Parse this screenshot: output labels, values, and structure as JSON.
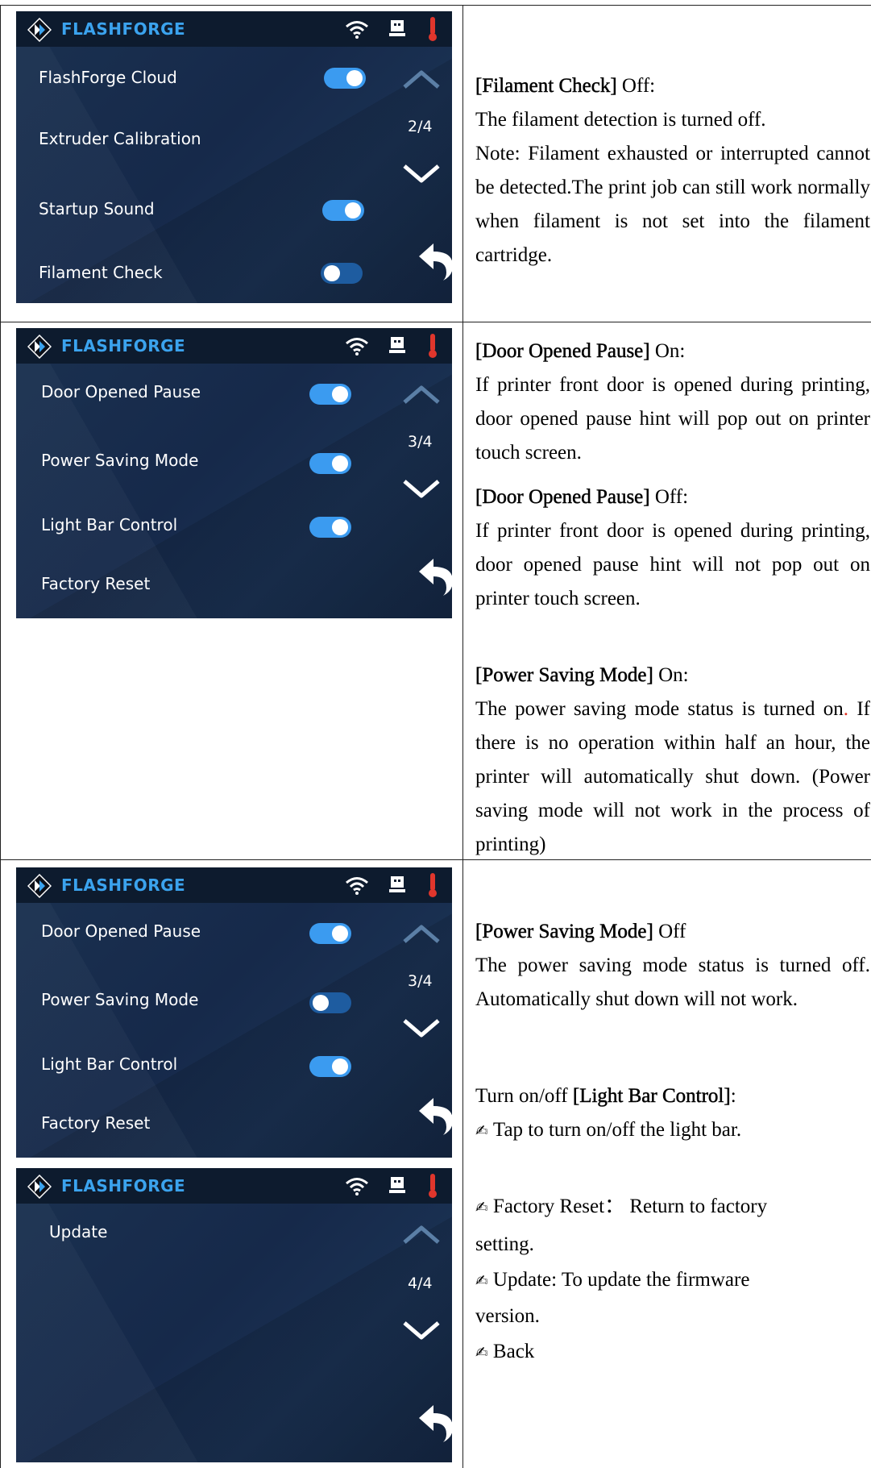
{
  "brand": "FLASHFORGE",
  "screens": [
    {
      "page": "2/4",
      "items": [
        "FlashForge Cloud",
        "Extruder Calibration",
        "Startup Sound",
        "Filament Check"
      ]
    },
    {
      "page": "3/4",
      "items": [
        "Door Opened Pause",
        "Power Saving Mode",
        "Light Bar Control",
        "Factory Reset"
      ]
    },
    {
      "page": "3/4",
      "items": [
        "Door Opened Pause",
        "Power Saving Mode",
        "Light Bar Control",
        "Factory Reset"
      ]
    },
    {
      "page": "4/4",
      "items": [
        "Update"
      ]
    }
  ],
  "toggle_states": {
    "s1": [
      "on",
      "",
      "on",
      "off"
    ],
    "s2": [
      "on",
      "on",
      "on",
      ""
    ],
    "s3": [
      "on",
      "off",
      "on",
      ""
    ]
  },
  "text": {
    "filament_check_title": "[Filament Check]",
    "filament_check_state": " Off:",
    "filament_check_line1": "The filament detection is turned off.",
    "filament_check_note": "Note: Filament exhausted or interrupted cannot be detected.The print job can still work normally when filament is not set into the filament cartridge.",
    "door_on_title": "[Door Opened Pause]",
    "door_on_state": " On:",
    "door_on_body": "If printer front door is opened during printing, door opened pause hint will pop out on printer touch screen.",
    "door_off_title": "[Door Opened Pause]",
    "door_off_state": " Off:",
    "door_off_body": "If printer front door is opened during printing, door opened pause hint will not pop out on printer touch screen.",
    "power_on_title": "[Power Saving Mode]",
    "power_on_state": " On:",
    "power_on_body_a": "The power saving mode status is turned on",
    "power_on_dot": ".",
    "power_on_body_b": " If there is no operation within half an hour, the printer will automatically shut down. (Power saving mode will not work in the process of printing)",
    "power_off_title": "[Power Saving Mode]",
    "power_off_state": " Off",
    "power_off_body": "The power saving mode status is turned off. Automatically shut down will not work.",
    "light_prefix": "Turn on/off ",
    "light_title": "[Light Bar Control]",
    "light_colon": ":",
    "light_tip": "Tap to turn on/off the light bar.",
    "factory_reset_line1": "Factory Reset： Return to factory",
    "factory_reset_line2": "setting.",
    "update_line1": "Update: To update the firmware",
    "update_line2": "version.",
    "back": "Back",
    "pen_glyph": "✍"
  },
  "colors": {
    "accent": "#3ba3ee",
    "toggle_on": "#3b9bf0",
    "toggle_off": "#1e5ca0",
    "thermometer": "#e0362c"
  }
}
